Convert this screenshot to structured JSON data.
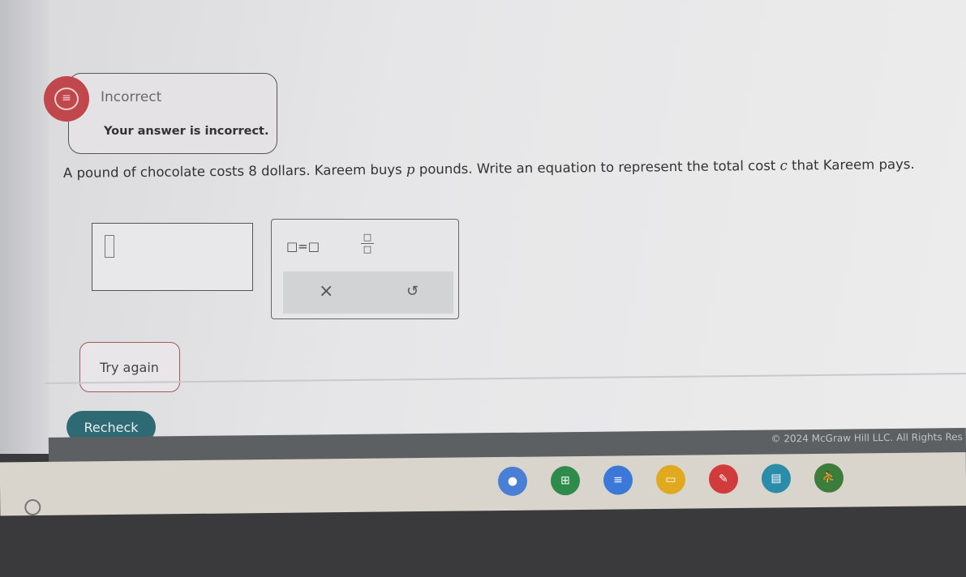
{
  "feedback": {
    "title": "Incorrect",
    "message": "Your answer is incorrect.",
    "icon": "chat-bubble-icon",
    "color": "#c0474b"
  },
  "question": {
    "before": "A pound of chocolate costs 8 dollars. Kareem buys ",
    "var1": "p",
    "middle": " pounds. Write an equation to represent the total cost ",
    "var2": "c",
    "after": " that Kareem pays."
  },
  "answer_input": {
    "value": ""
  },
  "palette": {
    "equation_label": "□=□",
    "fraction_num": "□",
    "fraction_den": "□",
    "clear_label": "×",
    "undo_label": "↺"
  },
  "buttons": {
    "try_again": "Try again",
    "recheck": "Recheck",
    "recheck_color": "#2e6a73"
  },
  "footer": {
    "copyright": "© 2024 McGraw Hill LLC. All Rights Res"
  },
  "shelf": {
    "apps": [
      {
        "name": "chrome",
        "color": "#4a7fd6",
        "glyph": "●"
      },
      {
        "name": "sheets",
        "color": "#2e8b4a",
        "glyph": "⊞"
      },
      {
        "name": "docs",
        "color": "#3b78d8",
        "glyph": "≡"
      },
      {
        "name": "slides",
        "color": "#e0a91e",
        "glyph": "▭"
      },
      {
        "name": "canvas",
        "color": "#d23b3b",
        "glyph": "✎"
      },
      {
        "name": "screencast",
        "color": "#2a8ca8",
        "glyph": "▤"
      },
      {
        "name": "classroom",
        "color": "#3c7d3c",
        "glyph": "⛹"
      }
    ]
  }
}
